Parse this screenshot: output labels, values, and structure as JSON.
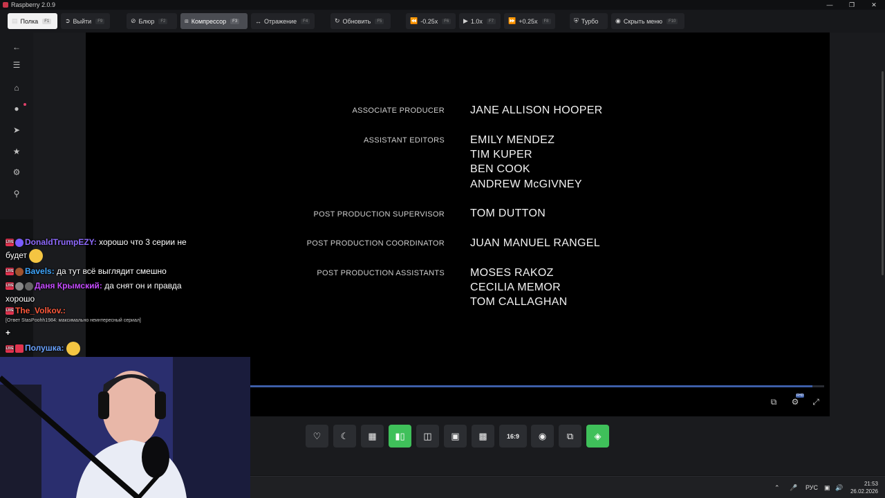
{
  "window": {
    "title": "Raspberry 2.0.9"
  },
  "toolbar": {
    "shelf": {
      "label": "Полка",
      "key": "F1"
    },
    "exit": {
      "label": "Выйти",
      "key": "F9"
    },
    "blur": {
      "label": "Блюр",
      "key": "F2"
    },
    "compressor": {
      "label": "Компрессор",
      "key": "F3"
    },
    "mirror": {
      "label": "Отражение",
      "key": "F4"
    },
    "refresh": {
      "label": "Обновить",
      "key": "F5"
    },
    "speed_down": {
      "label": "-0.25x",
      "key": "F6"
    },
    "speed": {
      "label": "1.0x",
      "key": "F7"
    },
    "speed_up": {
      "label": "+0.25x",
      "key": "F8"
    },
    "turbo": {
      "label": "Турбо"
    },
    "hide_menu": {
      "label": "Скрыть меню",
      "key": "F10"
    }
  },
  "sidebar": {
    "icons": [
      "back-arrow-icon",
      "menu-icon",
      "home-icon",
      "fire-icon",
      "telegram-icon",
      "trophy-icon",
      "gear-icon",
      "search-icon"
    ]
  },
  "credits": [
    {
      "role": "ASSOCIATE PRODUCER",
      "names": [
        "JANE ALLISON HOOPER"
      ]
    },
    {
      "role": "ASSISTANT EDITORS",
      "names": [
        "EMILY MENDEZ",
        "TIM KUPER",
        "BEN COOK",
        "ANDREW McGIVNEY"
      ]
    },
    {
      "role": "POST PRODUCTION SUPERVISOR",
      "names": [
        "TOM DUTTON"
      ]
    },
    {
      "role": "POST PRODUCTION COORDINATOR",
      "names": [
        "JUAN MANUEL RANGEL"
      ]
    },
    {
      "role": "POST PRODUCTION ASSISTANTS",
      "names": [
        "MOSES RAKOZ",
        "CECILIA MEMOR",
        "TOM CALLAGHAN"
      ]
    }
  ],
  "player": {
    "progress": 0.98,
    "quality_badge": "FHD",
    "aspect_label": "16:9",
    "accent_green": "#3fc05a"
  },
  "chat": [
    {
      "user": "DonaldTrumpEZY:",
      "color": "#8f6bff",
      "text": "хорошо что 3 серии не будет"
    },
    {
      "user": "Bavels:",
      "color": "#3fa7ff",
      "text": "да тут всё выглядит смешно"
    },
    {
      "user": "Даня Крымский:",
      "color": "#c64bff",
      "text": "да снят он и правда хорошо"
    },
    {
      "user": "The_Volkov.:",
      "color": "#ff5a3c",
      "text": "",
      "reply": "[Ответ StasPoohh1984: максимально неинтересный сериал]",
      "extra": "+"
    },
    {
      "user": "Полушка:",
      "color": "#6aa3ff",
      "text": ""
    }
  ],
  "taskbar": {
    "lang": "РУС",
    "time": "21:53",
    "date": "26.02.2026"
  }
}
